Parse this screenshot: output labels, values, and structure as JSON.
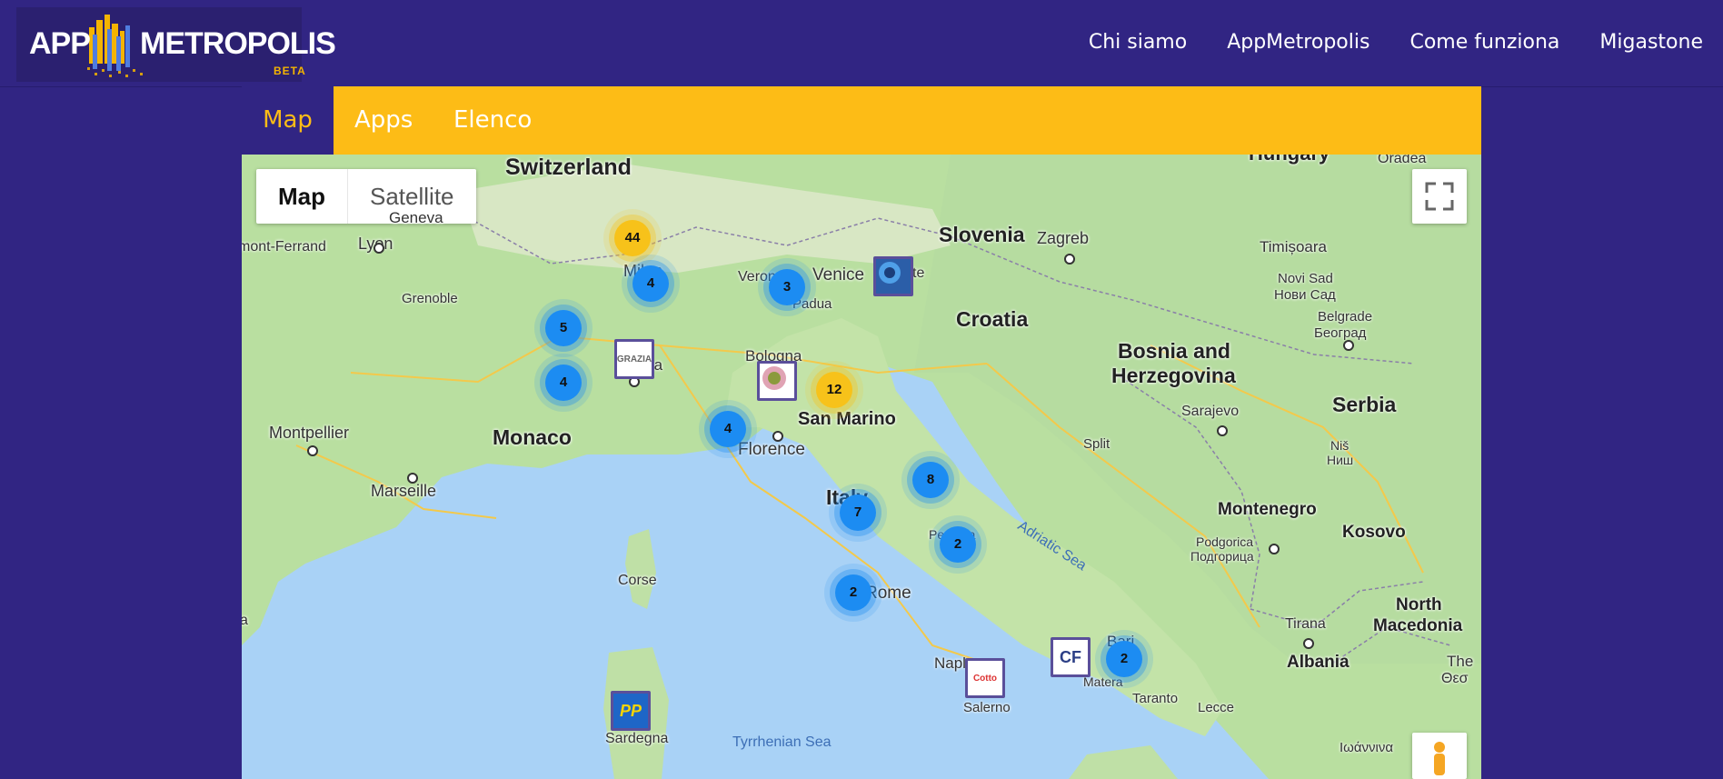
{
  "header": {
    "logo_word_left": "APP",
    "logo_word_right": "METROPOLIS",
    "logo_badge": "BETA",
    "nav": [
      "Chi siamo",
      "AppMetropolis",
      "Come funziona",
      "Migastone"
    ]
  },
  "tabs": {
    "map": "Map",
    "apps": "Apps",
    "list": "Elenco"
  },
  "map": {
    "type_map": "Map",
    "type_satellite": "Satellite",
    "fullscreen_icon": "fullscreen-icon",
    "pegman_icon": "street-view-pegman-icon",
    "colors": {
      "header_bg": "#312583",
      "tab_bar": "#fdbc16",
      "cluster_blue": "#1c8cf2",
      "cluster_yellow": "#f7c21a"
    },
    "clusters": [
      "44",
      "4",
      "3",
      "5",
      "4",
      "12",
      "4",
      "8",
      "7",
      "2",
      "2",
      "2"
    ],
    "pins": {
      "grazia": "GRAZIA",
      "cf": "CF",
      "pp": "PP",
      "cotto": "Cotto"
    },
    "countries": {
      "switzerland": "Switzerland",
      "hungary": "Hungary",
      "slovenia": "Slovenia",
      "croatia": "Croatia",
      "bosnia_1": "Bosnia and",
      "bosnia_2": "Herzegovina",
      "serbia": "Serbia",
      "monaco": "Monaco",
      "san_marino": "San Marino",
      "italy": "Italy",
      "montenegro": "Montenegro",
      "kosovo": "Kosovo",
      "north_mac_1": "North",
      "north_mac_2": "Macedonia",
      "albania": "Albania"
    },
    "cities": {
      "oradea": "Oradea",
      "geneva": "Geneva",
      "clermont": "mont-Ferrand",
      "lyon": "Lyon",
      "zagreb": "Zagreb",
      "timisoara": "Timișoara",
      "milan": "Milan",
      "verona": "Verona",
      "venice": "Venice",
      "trieste": "ste",
      "padua": "Padua",
      "novi_sad": "Novi Sad",
      "novi_sad_cyr": "Нови Сад",
      "belgrade": "Belgrade",
      "belgrade_cyr": "Београд",
      "grenoble": "Grenoble",
      "genoa": "Genoa",
      "bologna": "Bologna",
      "sarajevo": "Sarajevo",
      "montpellier": "Montpellier",
      "florence": "Florence",
      "split": "Split",
      "nis": "Niš",
      "nis_cyr": "Ниш",
      "marseille": "Marseille",
      "pescara": "Pescara",
      "podgorica": "Podgorica",
      "podgorica_cyr": "Подгорица",
      "corse": "Corse",
      "rome": "Rome",
      "tirana": "Tirana",
      "bari": "Bari",
      "naples": "Naples",
      "matera": "Matera",
      "taranto": "Taranto",
      "lecce": "Lecce",
      "salerno": "Salerno",
      "sardegna": "Sardegna",
      "the": "The",
      "thess_cyr": "Θεσ",
      "ioannina_cyr": "Ιωάννινα",
      "edge_a": "a"
    },
    "seas": {
      "adriatic": "Adriatic Sea",
      "tyrrhenian": "Tyrrhenian Sea"
    }
  }
}
